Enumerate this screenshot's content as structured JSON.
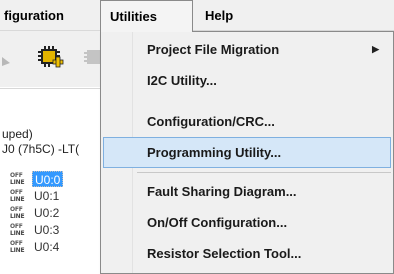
{
  "menubar": {
    "items": [
      {
        "label": "figuration"
      },
      {
        "label": "Utilities"
      },
      {
        "label": "Help"
      }
    ]
  },
  "tree": {
    "line1": "uped)",
    "line2": "J0 (7h5C) -LT(",
    "offline_badge": {
      "top": "OFF",
      "bottom": "LINE"
    },
    "nodes": [
      {
        "label": "U0:0",
        "selected": true
      },
      {
        "label": "U0:1",
        "selected": false
      },
      {
        "label": "U0:2",
        "selected": false
      },
      {
        "label": "U0:3",
        "selected": false
      },
      {
        "label": "U0:4",
        "selected": false
      }
    ]
  },
  "utilities_menu": {
    "items": [
      {
        "label": "Project File Migration",
        "has_submenu": true
      },
      {
        "label": "I2C Utility..."
      },
      {
        "label": "Configuration/CRC..."
      },
      {
        "label": "Programming Utility...",
        "highlighted": true
      },
      {
        "label": "Fault Sharing Diagram..."
      },
      {
        "label": "On/Off Configuration..."
      },
      {
        "label": "Resistor Selection Tool..."
      }
    ],
    "submenu_arrow": "▶"
  },
  "colors": {
    "selection": "#3399ff",
    "highlight": "#d5e7f8",
    "highlight_border": "#7fb0e0",
    "chip_icon": "#e3b400"
  },
  "toolbar": {
    "icons": [
      "partial-icon",
      "chip-add-icon",
      "chip-disabled-icon"
    ]
  }
}
